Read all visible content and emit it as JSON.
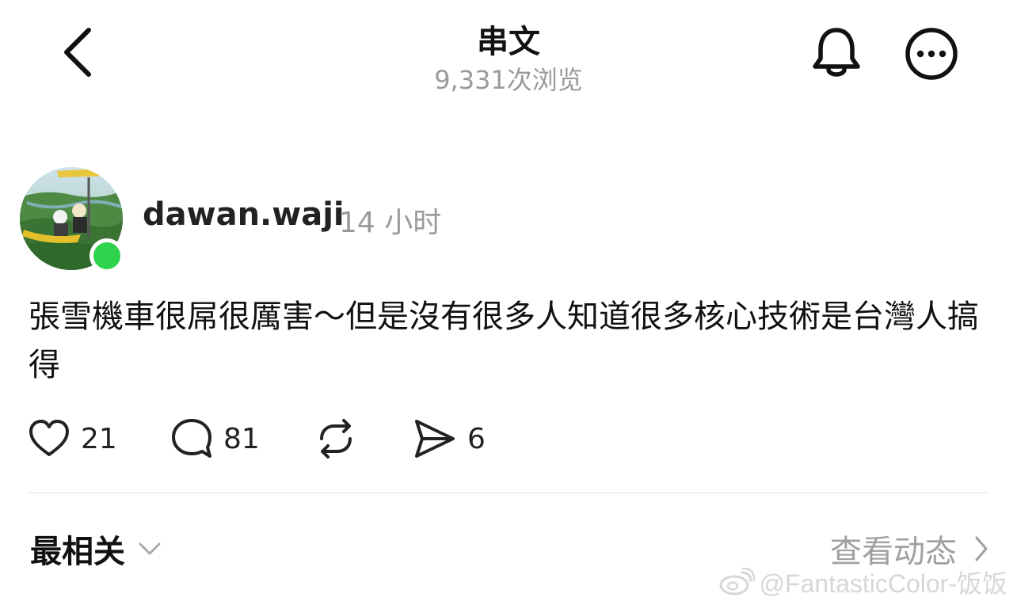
{
  "header": {
    "title": "串文",
    "views": "9,331次浏览"
  },
  "post": {
    "username": "dawan.waji",
    "time": "14 小时",
    "text": "張雪機車很屌很厲害～但是沒有很多人知道很多核心技術是台灣人搞得",
    "likes": "21",
    "comments": "81",
    "shares": "6"
  },
  "footer": {
    "sort_label": "最相关",
    "activity_label": "查看动态",
    "watermark": "@FantasticColor-饭饭"
  },
  "colors": {
    "online": "#2fd34b",
    "muted_text": "#9a9a9a"
  },
  "icons": [
    "back-icon",
    "bell-icon",
    "more-icon",
    "heart-icon",
    "comment-icon",
    "repost-icon",
    "send-icon",
    "chevron-down-icon",
    "chevron-right-icon",
    "weibo-icon"
  ]
}
